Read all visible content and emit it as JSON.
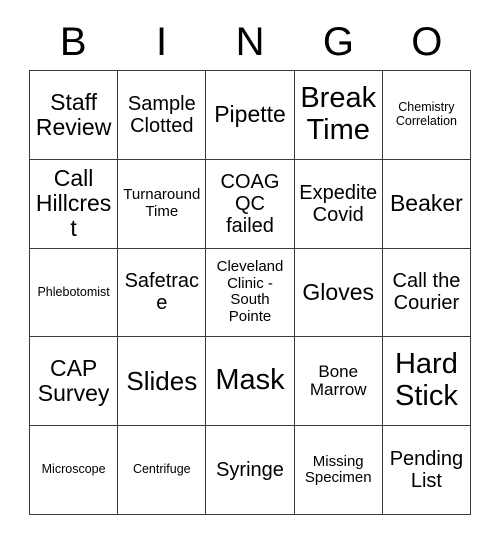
{
  "header": {
    "letters": [
      "B",
      "I",
      "N",
      "G",
      "O"
    ]
  },
  "grid": {
    "columns": 5,
    "rows": 5,
    "border_color": "#3a3a3a",
    "background_color": "#ffffff",
    "text_color": "#000000",
    "cells": [
      [
        {
          "text": "Staff Review",
          "size": "l"
        },
        {
          "text": "Sample Clotted",
          "size": "m"
        },
        {
          "text": "Pipette",
          "size": "l"
        },
        {
          "text": "Break Time",
          "size": "xxl"
        },
        {
          "text": "Chemistry Correlation",
          "size": "xxs"
        }
      ],
      [
        {
          "text": "Call Hillcrest",
          "size": "l"
        },
        {
          "text": "Turnaround Time",
          "size": "xs"
        },
        {
          "text": "COAG QC failed",
          "size": "m"
        },
        {
          "text": "Expedite Covid",
          "size": "m"
        },
        {
          "text": "Beaker",
          "size": "l"
        }
      ],
      [
        {
          "text": "Phlebotomist",
          "size": "xxs"
        },
        {
          "text": "Safetrace",
          "size": "m"
        },
        {
          "text": "Cleveland Clinic - South Pointe",
          "size": "xs"
        },
        {
          "text": "Gloves",
          "size": "l"
        },
        {
          "text": "Call the Courier",
          "size": "m"
        }
      ],
      [
        {
          "text": "CAP Survey",
          "size": "l"
        },
        {
          "text": "Slides",
          "size": "xl"
        },
        {
          "text": "Mask",
          "size": "xxl"
        },
        {
          "text": "Bone Marrow",
          "size": "s"
        },
        {
          "text": "Hard Stick",
          "size": "xxl"
        }
      ],
      [
        {
          "text": "Microscope",
          "size": "xxs"
        },
        {
          "text": "Centrifuge",
          "size": "xxs"
        },
        {
          "text": "Syringe",
          "size": "m"
        },
        {
          "text": "Missing Specimen",
          "size": "xs"
        },
        {
          "text": "Pending List",
          "size": "m"
        }
      ]
    ]
  }
}
